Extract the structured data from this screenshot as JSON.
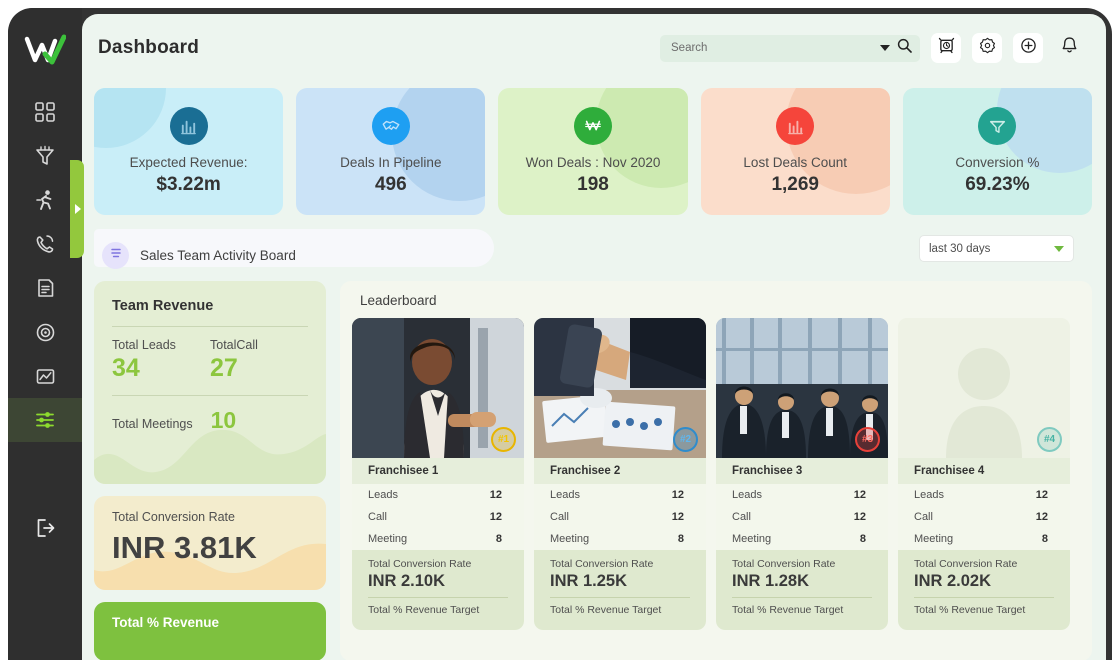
{
  "header": {
    "title": "Dashboard",
    "search": {
      "placeholder": "Search",
      "value": ""
    },
    "icons": [
      "alarm-clock-icon",
      "settings-badge-icon",
      "plus-circle-icon",
      "bell-icon"
    ]
  },
  "sidebar": {
    "logo": "w-check-logo",
    "items": [
      {
        "name": "dashboard",
        "icon": "grid-icon",
        "active": false
      },
      {
        "name": "funnel",
        "icon": "funnel-icon",
        "active": false
      },
      {
        "name": "activity",
        "icon": "running-person-icon",
        "active": false
      },
      {
        "name": "calls",
        "icon": "phone-call-icon",
        "active": false
      },
      {
        "name": "documents",
        "icon": "document-icon",
        "active": false
      },
      {
        "name": "targets",
        "icon": "target-icon",
        "active": false
      },
      {
        "name": "reports",
        "icon": "image-chart-icon",
        "active": false
      },
      {
        "name": "settings-filters",
        "icon": "sliders-icon",
        "active": true
      }
    ],
    "logout": "logout-icon",
    "expand_handle": "expand-arrow-icon"
  },
  "kpis": [
    {
      "label": "Expected Revenue:",
      "value": "$3.22m",
      "icon": "bar-chart-icon",
      "bg": "#c9eef8",
      "blob": "#b5e4f2",
      "icon_bg": "#1a6e94"
    },
    {
      "label": "Deals In Pipeline",
      "value": "496",
      "icon": "handshake-icon",
      "bg": "#cbe3f7",
      "blob": "#b3d3ef",
      "icon_bg": "#1e9ff2"
    },
    {
      "label": "Won Deals : Nov 2020",
      "value": "198",
      "icon": "won-currency-icon",
      "bg": "#ddf2c7",
      "blob": "#cdeab1",
      "icon_bg": "#2fad3b"
    },
    {
      "label": "Lost Deals Count",
      "value": "1,269",
      "icon": "bar-chart-down-icon",
      "bg": "#fbddcb",
      "blob": "#f7ccb4",
      "icon_bg": "#f5453b"
    },
    {
      "label": "Conversion %",
      "value": "69.23%",
      "icon": "funnel-icon",
      "bg": "#cdf0ea",
      "blob": "#bfe0ef",
      "icon_bg": "#23a391"
    }
  ],
  "board": {
    "title": "Sales Team Activity Board",
    "icon": "list-lines-icon",
    "range": {
      "label": "last 30 days",
      "caret": "chevron-down-icon"
    }
  },
  "team_revenue": {
    "title": "Team Revenue",
    "leads_label": "Total Leads",
    "leads_value": "34",
    "calls_label": "TotalCall",
    "calls_value": "27",
    "meetings_label": "Total  Meetings",
    "meetings_value": "10"
  },
  "conversion_card": {
    "label": "Total  Conversion Rate",
    "value": "INR 3.81K"
  },
  "revenue_card": {
    "label": "Total  % Revenue"
  },
  "leaderboard": {
    "title": "Leaderboard",
    "cards": [
      {
        "name": "Franchisee 1",
        "rank": "#1",
        "rank_color": "#e8b500",
        "rank_bg": "rgba(232,181,0,0.25)",
        "leads_label": "Leads",
        "leads_value": "12",
        "call_label": "Call",
        "call_value": "12",
        "meeting_label": "Meeting",
        "meeting_value": "8",
        "conv_label": "Total  Conversion Rate",
        "conv_value": "INR 2.10K",
        "target_label": "Total  % Revenue Target"
      },
      {
        "name": "Franchisee 2",
        "rank": "#2",
        "rank_color": "#2f8ccc",
        "rank_bg": "rgba(47,140,204,0.28)",
        "leads_label": "Leads",
        "leads_value": "12",
        "call_label": "Call",
        "call_value": "12",
        "meeting_label": "Meeting",
        "meeting_value": "8",
        "conv_label": "Total  Conversion Rate",
        "conv_value": "INR 1.25K",
        "target_label": "Total  % Revenue Target"
      },
      {
        "name": "Franchisee 3",
        "rank": "#3",
        "rank_color": "#e8413a",
        "rank_bg": "rgba(232,65,58,0.25)",
        "leads_label": "Leads",
        "leads_value": "12",
        "call_label": "Call",
        "call_value": "12",
        "meeting_label": "Meeting",
        "meeting_value": "8",
        "conv_label": "Total  Conversion Rate",
        "conv_value": "INR 1.28K",
        "target_label": "Total  % Revenue Target"
      },
      {
        "name": "Franchisee 4",
        "rank": "#4",
        "rank_color": "#46b3a4",
        "rank_bg": "rgba(70,179,164,0.22)",
        "leads_label": "Leads",
        "leads_value": "12",
        "call_label": "Call",
        "call_value": "12",
        "meeting_label": "Meeting",
        "meeting_value": "8",
        "conv_label": "Total  Conversion Rate",
        "conv_value": "INR 2.02K",
        "target_label": "Total  % Revenue Target"
      }
    ]
  }
}
